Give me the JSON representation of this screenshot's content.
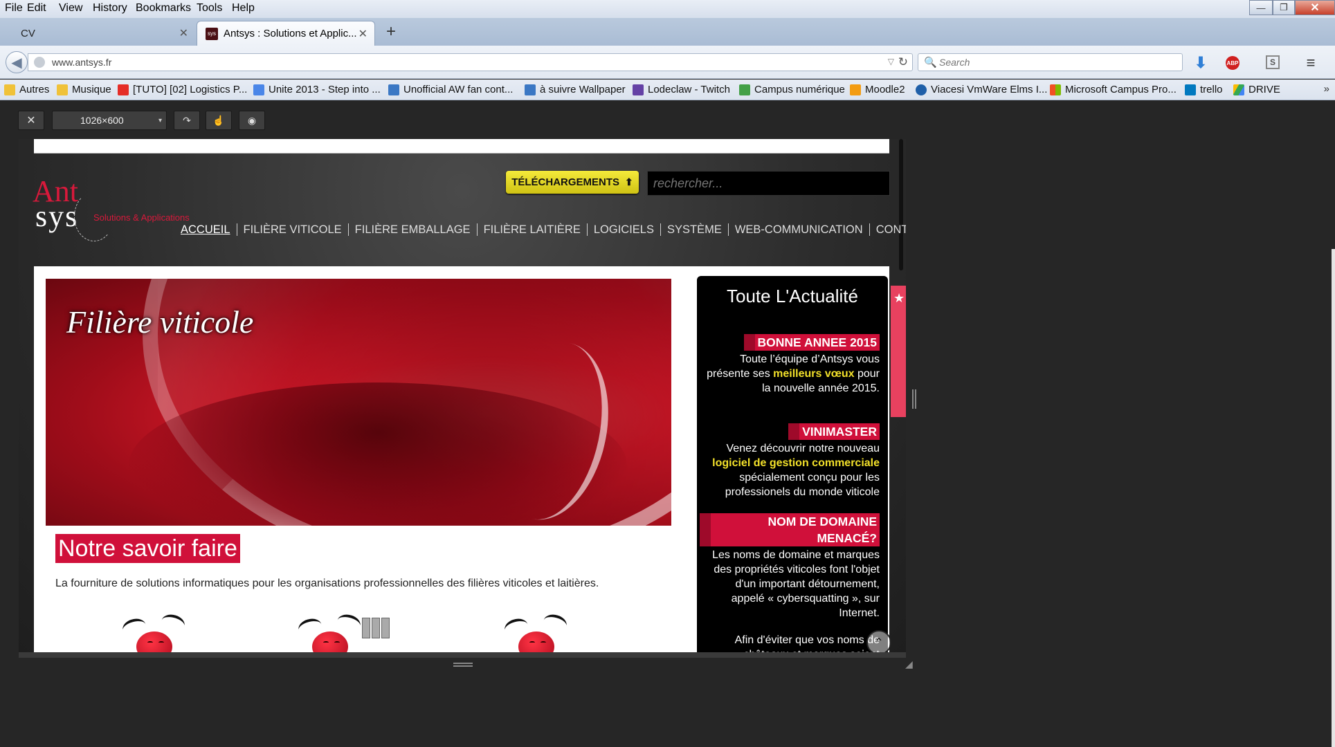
{
  "menubar": {
    "items": [
      {
        "label": "File"
      },
      {
        "label": "Edit"
      },
      {
        "label": "View"
      },
      {
        "label": "History"
      },
      {
        "label": "Bookmarks"
      },
      {
        "label": "Tools"
      },
      {
        "label": "Help"
      }
    ]
  },
  "window_controls": {
    "minimize": "—",
    "maximize": "❐",
    "close": "✕"
  },
  "tabs": [
    {
      "label": "CV",
      "active": false
    },
    {
      "label": "Antsys : Solutions et Applic...",
      "active": true,
      "favicon_text": "sys"
    }
  ],
  "tab_close_glyph": "✕",
  "new_tab_glyph": "+",
  "navbar": {
    "back_icon": "◀",
    "url": "www.antsys.fr",
    "dropdown_icon": "▽",
    "reload_icon": "↻",
    "search_placeholder": "Search",
    "search_icon": "🔍",
    "download_icon": "⬇",
    "abp_label": "ABP",
    "sync_icon_label": "S",
    "menu_icon": "≡"
  },
  "bookmarks": {
    "items": [
      {
        "label": "Autres",
        "icon": "folder-icon",
        "color": "#f0c239"
      },
      {
        "label": "Musique",
        "icon": "folder-icon",
        "color": "#f0c239"
      },
      {
        "label": "[TUTO] [02] Logistics P...",
        "icon": "youtube-icon",
        "color": "#e52d27"
      },
      {
        "label": "Unite 2013 - Step into ...",
        "icon": "google-icon",
        "color": "#4a86e8"
      },
      {
        "label": "Unofficial AW fan cont...",
        "icon": "wiki-icon",
        "color": "#3b78c4"
      },
      {
        "label": "à suivre Wallpaper",
        "icon": "w-icon",
        "color": "#3b78c4"
      },
      {
        "label": "Lodeclaw - Twitch",
        "icon": "twitch-icon",
        "color": "#6441a5"
      },
      {
        "label": "Campus numérique",
        "icon": "cube-icon",
        "color": "#43a047"
      },
      {
        "label": "Moodle2",
        "icon": "moodle-icon",
        "color": "#f39c12"
      },
      {
        "label": "Viacesi VmWare Elms I...",
        "icon": "vmware-icon",
        "color": "#1f5fa8"
      },
      {
        "label": "Microsoft Campus Pro...",
        "icon": "microsoft-icon",
        "color": "#f25022"
      },
      {
        "label": "trello",
        "icon": "trello-icon",
        "color": "#0079bf"
      },
      {
        "label": "DRIVE",
        "icon": "drive-icon",
        "color": "#34a853"
      }
    ],
    "overflow": "»"
  },
  "responsive_toolbar": {
    "close": "✕",
    "size_value": "1026×600",
    "caret": "▾",
    "rotate_icon": "↷",
    "touch_icon": "☝",
    "screenshot_icon": "◉"
  },
  "site": {
    "logo": {
      "ant": "Ant",
      "sys": "sys",
      "tagline": "Solutions & Applications"
    },
    "download_button": "TÉLÉCHARGEMENTS",
    "download_icon": "⬆",
    "search_placeholder": "rechercher...",
    "nav": [
      {
        "label": "ACCUEIL",
        "current": true
      },
      {
        "label": "FILIÈRE VITICOLE"
      },
      {
        "label": "FILIÈRE EMBALLAGE"
      },
      {
        "label": "FILIÈRE LAITIÈRE"
      },
      {
        "label": "LOGICIELS"
      },
      {
        "label": "SYSTÈME"
      },
      {
        "label": "WEB-COMMUNICATION"
      },
      {
        "label": "CONTACT"
      }
    ],
    "hero_title": "Filière viticole",
    "savoir_title": "Notre savoir faire",
    "savoir_text": "La fourniture de solutions informatiques pour les organisations professionnelles des filières viticoles et laitières.",
    "news": {
      "heading": "Toute L'Actualité",
      "items": [
        {
          "title": "BONNE ANNEE 2015",
          "pre": "Toute l’équipe d’Antsys vous présente ses ",
          "highlight": "meilleurs vœux",
          "post": " pour la nouvelle année 2015."
        },
        {
          "title": "VINIMASTER",
          "pre": "Venez découvrir notre nouveau ",
          "highlight": "logiciel de gestion commerciale",
          "post": " spécialement conçu pour les professionels du monde viticole"
        },
        {
          "title": "NOM DE DOMAINE MENACÉ?",
          "pre": "Les noms de domaine et marques des propriétés viticoles font l'objet d'un important détournement, appelé « cybersquatting », sur Internet.",
          "highlight": "",
          "post": ""
        },
        {
          "title": "",
          "pre": "Afin d'éviter que vos noms de châteaux et marques soient",
          "highlight": "",
          "post": ""
        }
      ]
    },
    "side_tab_icon": "★",
    "scroll_top_icon": "⌃"
  }
}
